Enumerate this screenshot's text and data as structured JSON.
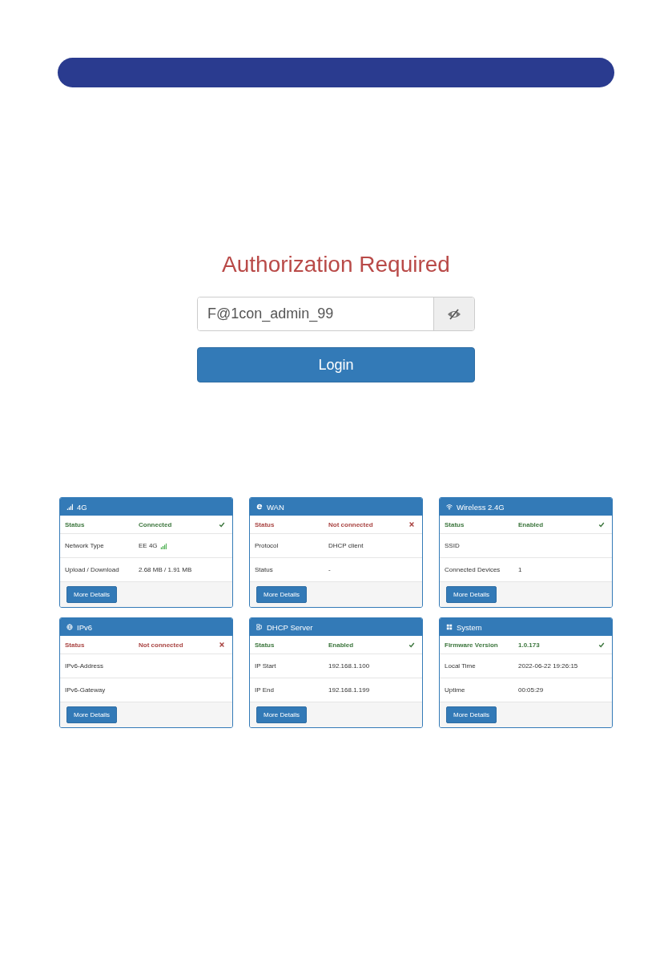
{
  "login": {
    "title": "Authorization Required",
    "password": {
      "value": "F@1con_admin_99",
      "visible": true
    },
    "button": "Login"
  },
  "cards": [
    {
      "kind": "signal",
      "title": "4G",
      "rows": [
        {
          "label": "Status",
          "value": "Connected",
          "kind": "ok"
        },
        {
          "label": "Network Type",
          "value": "EE 4G",
          "signal": true
        },
        {
          "label": "Upload / Download",
          "value": "2.68 MB / 1.91 MB"
        }
      ],
      "button": "More Details"
    },
    {
      "kind": "browser",
      "title": "WAN",
      "rows": [
        {
          "label": "Status",
          "value": "Not connected",
          "kind": "error"
        },
        {
          "label": "Protocol",
          "value": "DHCP client"
        },
        {
          "label": "Status",
          "value": "-"
        }
      ],
      "button": "More Details"
    },
    {
      "kind": "wifi",
      "title": "Wireless 2.4G",
      "rows": [
        {
          "label": "Status",
          "value": "Enabled",
          "kind": "ok"
        },
        {
          "label": "SSID"
        },
        {
          "label": "Connected Devices",
          "value": "1"
        }
      ],
      "button": "More Details"
    },
    {
      "kind": "globe",
      "title": "IPv6",
      "rows": [
        {
          "label": "Status",
          "value": "Not connected",
          "kind": "error"
        },
        {
          "label": "IPv6-Address"
        },
        {
          "label": "IPv6-Gateway"
        }
      ],
      "button": "More Details"
    },
    {
      "kind": "network",
      "title": "DHCP Server",
      "rows": [
        {
          "label": "Status",
          "value": "Enabled",
          "kind": "ok"
        },
        {
          "label": "IP Start",
          "value": "192.168.1.100"
        },
        {
          "label": "IP End",
          "value": "192.168.1.199"
        }
      ],
      "button": "More Details"
    },
    {
      "kind": "grid",
      "title": "System",
      "rows": [
        {
          "label": "Firmware Version",
          "value": "1.0.173",
          "kind": "ok"
        },
        {
          "label": "Local Time",
          "value": "2022-06-22 19:26:15"
        },
        {
          "label": "Uptime",
          "value": "00:05:29"
        }
      ],
      "button": "More Details"
    }
  ]
}
